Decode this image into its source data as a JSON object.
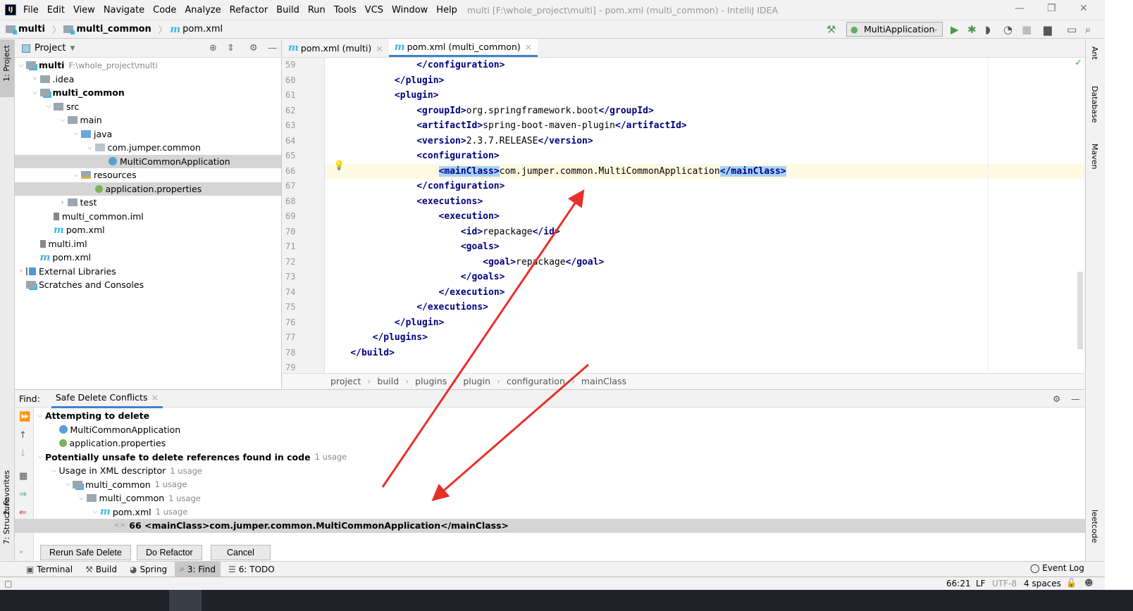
{
  "window": {
    "title": "multi [F:\\whole_project\\multi] - pom.xml (multi_common) - IntelliJ IDEA",
    "logo": "IJ"
  },
  "menu": [
    "File",
    "Edit",
    "View",
    "Navigate",
    "Code",
    "Analyze",
    "Refactor",
    "Build",
    "Run",
    "Tools",
    "VCS",
    "Window",
    "Help"
  ],
  "navbar": {
    "crumbs": [
      "multi",
      "multi_common",
      "pom.xml"
    ],
    "run_config": "MultiApplication"
  },
  "left_stripe": {
    "project": "1: Project",
    "favorites": "2: Favorites",
    "structure": "7: Structure"
  },
  "right_stripe": {
    "ant": "Ant",
    "database": "Database",
    "maven": "Maven",
    "leetcode": "leetcode"
  },
  "project": {
    "header": "Project",
    "items": [
      {
        "depth": 0,
        "arrow": "down",
        "icon": "module",
        "label": "multi",
        "bold": true,
        "extra": "F:\\whole_project\\multi"
      },
      {
        "depth": 1,
        "arrow": "right",
        "icon": "folder",
        "label": ".idea"
      },
      {
        "depth": 1,
        "arrow": "down",
        "icon": "module",
        "label": "multi_common",
        "bold": true
      },
      {
        "depth": 2,
        "arrow": "down",
        "icon": "folder",
        "label": "src"
      },
      {
        "depth": 3,
        "arrow": "down",
        "icon": "folder",
        "label": "main"
      },
      {
        "depth": 4,
        "arrow": "down",
        "icon": "src",
        "label": "java"
      },
      {
        "depth": 5,
        "arrow": "down",
        "icon": "package",
        "label": "com.jumper.common"
      },
      {
        "depth": 6,
        "arrow": "",
        "icon": "spring-class",
        "label": "MultiCommonApplication",
        "selected": true
      },
      {
        "depth": 4,
        "arrow": "down",
        "icon": "res",
        "label": "resources"
      },
      {
        "depth": 5,
        "arrow": "",
        "icon": "properties",
        "label": "application.properties",
        "selected": true
      },
      {
        "depth": 3,
        "arrow": "right",
        "icon": "folder",
        "label": "test"
      },
      {
        "depth": 2,
        "arrow": "",
        "icon": "iml",
        "label": "multi_common.iml"
      },
      {
        "depth": 2,
        "arrow": "",
        "icon": "maven",
        "label": "pom.xml"
      },
      {
        "depth": 1,
        "arrow": "",
        "icon": "iml",
        "label": "multi.iml"
      },
      {
        "depth": 1,
        "arrow": "",
        "icon": "maven",
        "label": "pom.xml"
      },
      {
        "depth": 0,
        "arrow": "right",
        "icon": "libraries",
        "label": "External Libraries"
      },
      {
        "depth": 0,
        "arrow": "",
        "icon": "scratches",
        "label": "Scratches and Consoles"
      }
    ]
  },
  "editor": {
    "tabs": [
      {
        "label": "pom.xml (multi)",
        "active": false
      },
      {
        "label": "pom.xml (multi_common)",
        "active": true
      }
    ],
    "lines": [
      {
        "n": "59",
        "text": "                </configuration>"
      },
      {
        "n": "60",
        "text": "            </plugin>"
      },
      {
        "n": "61",
        "text": "            <plugin>"
      },
      {
        "n": "62",
        "text": "                <groupId>org.springframework.boot</groupId>"
      },
      {
        "n": "63",
        "text": "                <artifactId>spring-boot-maven-plugin</artifactId>"
      },
      {
        "n": "64",
        "text": "                <version>2.3.7.RELEASE</version>"
      },
      {
        "n": "65",
        "text": "                <configuration>"
      },
      {
        "n": "66",
        "text": "                    <mainClass>com.jumper.common.MultiCommonApplication</mainClass>",
        "current": true
      },
      {
        "n": "67",
        "text": "                </configuration>"
      },
      {
        "n": "68",
        "text": "                <executions>"
      },
      {
        "n": "69",
        "text": "                    <execution>"
      },
      {
        "n": "70",
        "text": "                        <id>repackage</id>"
      },
      {
        "n": "71",
        "text": "                        <goals>"
      },
      {
        "n": "72",
        "text": "                            <goal>repackage</goal>"
      },
      {
        "n": "73",
        "text": "                        </goals>"
      },
      {
        "n": "74",
        "text": "                    </execution>"
      },
      {
        "n": "75",
        "text": "                </executions>"
      },
      {
        "n": "76",
        "text": "            </plugin>"
      },
      {
        "n": "77",
        "text": "        </plugins>"
      },
      {
        "n": "78",
        "text": "    </build>"
      },
      {
        "n": "79",
        "text": ""
      }
    ],
    "breadcrumbs": [
      "project",
      "build",
      "plugins",
      "plugin",
      "configuration",
      "mainClass"
    ]
  },
  "find": {
    "label": "Find:",
    "tab": "Safe Delete Conflicts",
    "items": [
      {
        "depth": 0,
        "arrow": "down",
        "label": "Attempting to delete",
        "bold": true
      },
      {
        "depth": 1,
        "arrow": "",
        "icon": "spring-class",
        "label": "MultiCommonApplication"
      },
      {
        "depth": 1,
        "arrow": "",
        "icon": "properties",
        "label": "application.properties"
      },
      {
        "depth": 0,
        "arrow": "down",
        "label": "Potentially unsafe to delete references found in code",
        "bold": true,
        "extra": "1 usage"
      },
      {
        "depth": 1,
        "arrow": "down",
        "label": "Usage in XML descriptor",
        "extra": "1 usage"
      },
      {
        "depth": 2,
        "arrow": "down",
        "icon": "module",
        "label": "multi_common",
        "extra": "1 usage"
      },
      {
        "depth": 3,
        "arrow": "down",
        "icon": "folder",
        "label": "multi_common",
        "extra": "1 usage"
      },
      {
        "depth": 4,
        "arrow": "down",
        "icon": "maven",
        "label": "pom.xml",
        "extra": "1 usage"
      },
      {
        "depth": 5,
        "arrow": "",
        "icon": "xml",
        "label": "66 <mainClass>com.jumper.common.MultiCommonApplication</mainClass>",
        "selected": true
      }
    ],
    "buttons": {
      "rerun": "Rerun Safe Delete",
      "refactor": "Do Refactor",
      "cancel": "Cancel"
    }
  },
  "bottom_tools": [
    {
      "label": "Terminal",
      "icon": "terminal"
    },
    {
      "label": "Build",
      "icon": "hammer"
    },
    {
      "label": "Spring",
      "icon": "spring"
    },
    {
      "label": "3: Find",
      "icon": "search",
      "active": true
    },
    {
      "label": "6: TODO",
      "icon": "list"
    }
  ],
  "event_log": "Event Log",
  "status": {
    "position": "66:21",
    "line_sep": "LF",
    "encoding": "UTF-8",
    "indent": "4 spaces"
  },
  "colors": {
    "accent": "#4083c9",
    "tag": "#000080",
    "highlight": "#a6d2ff",
    "annotation": "#e8302a"
  }
}
